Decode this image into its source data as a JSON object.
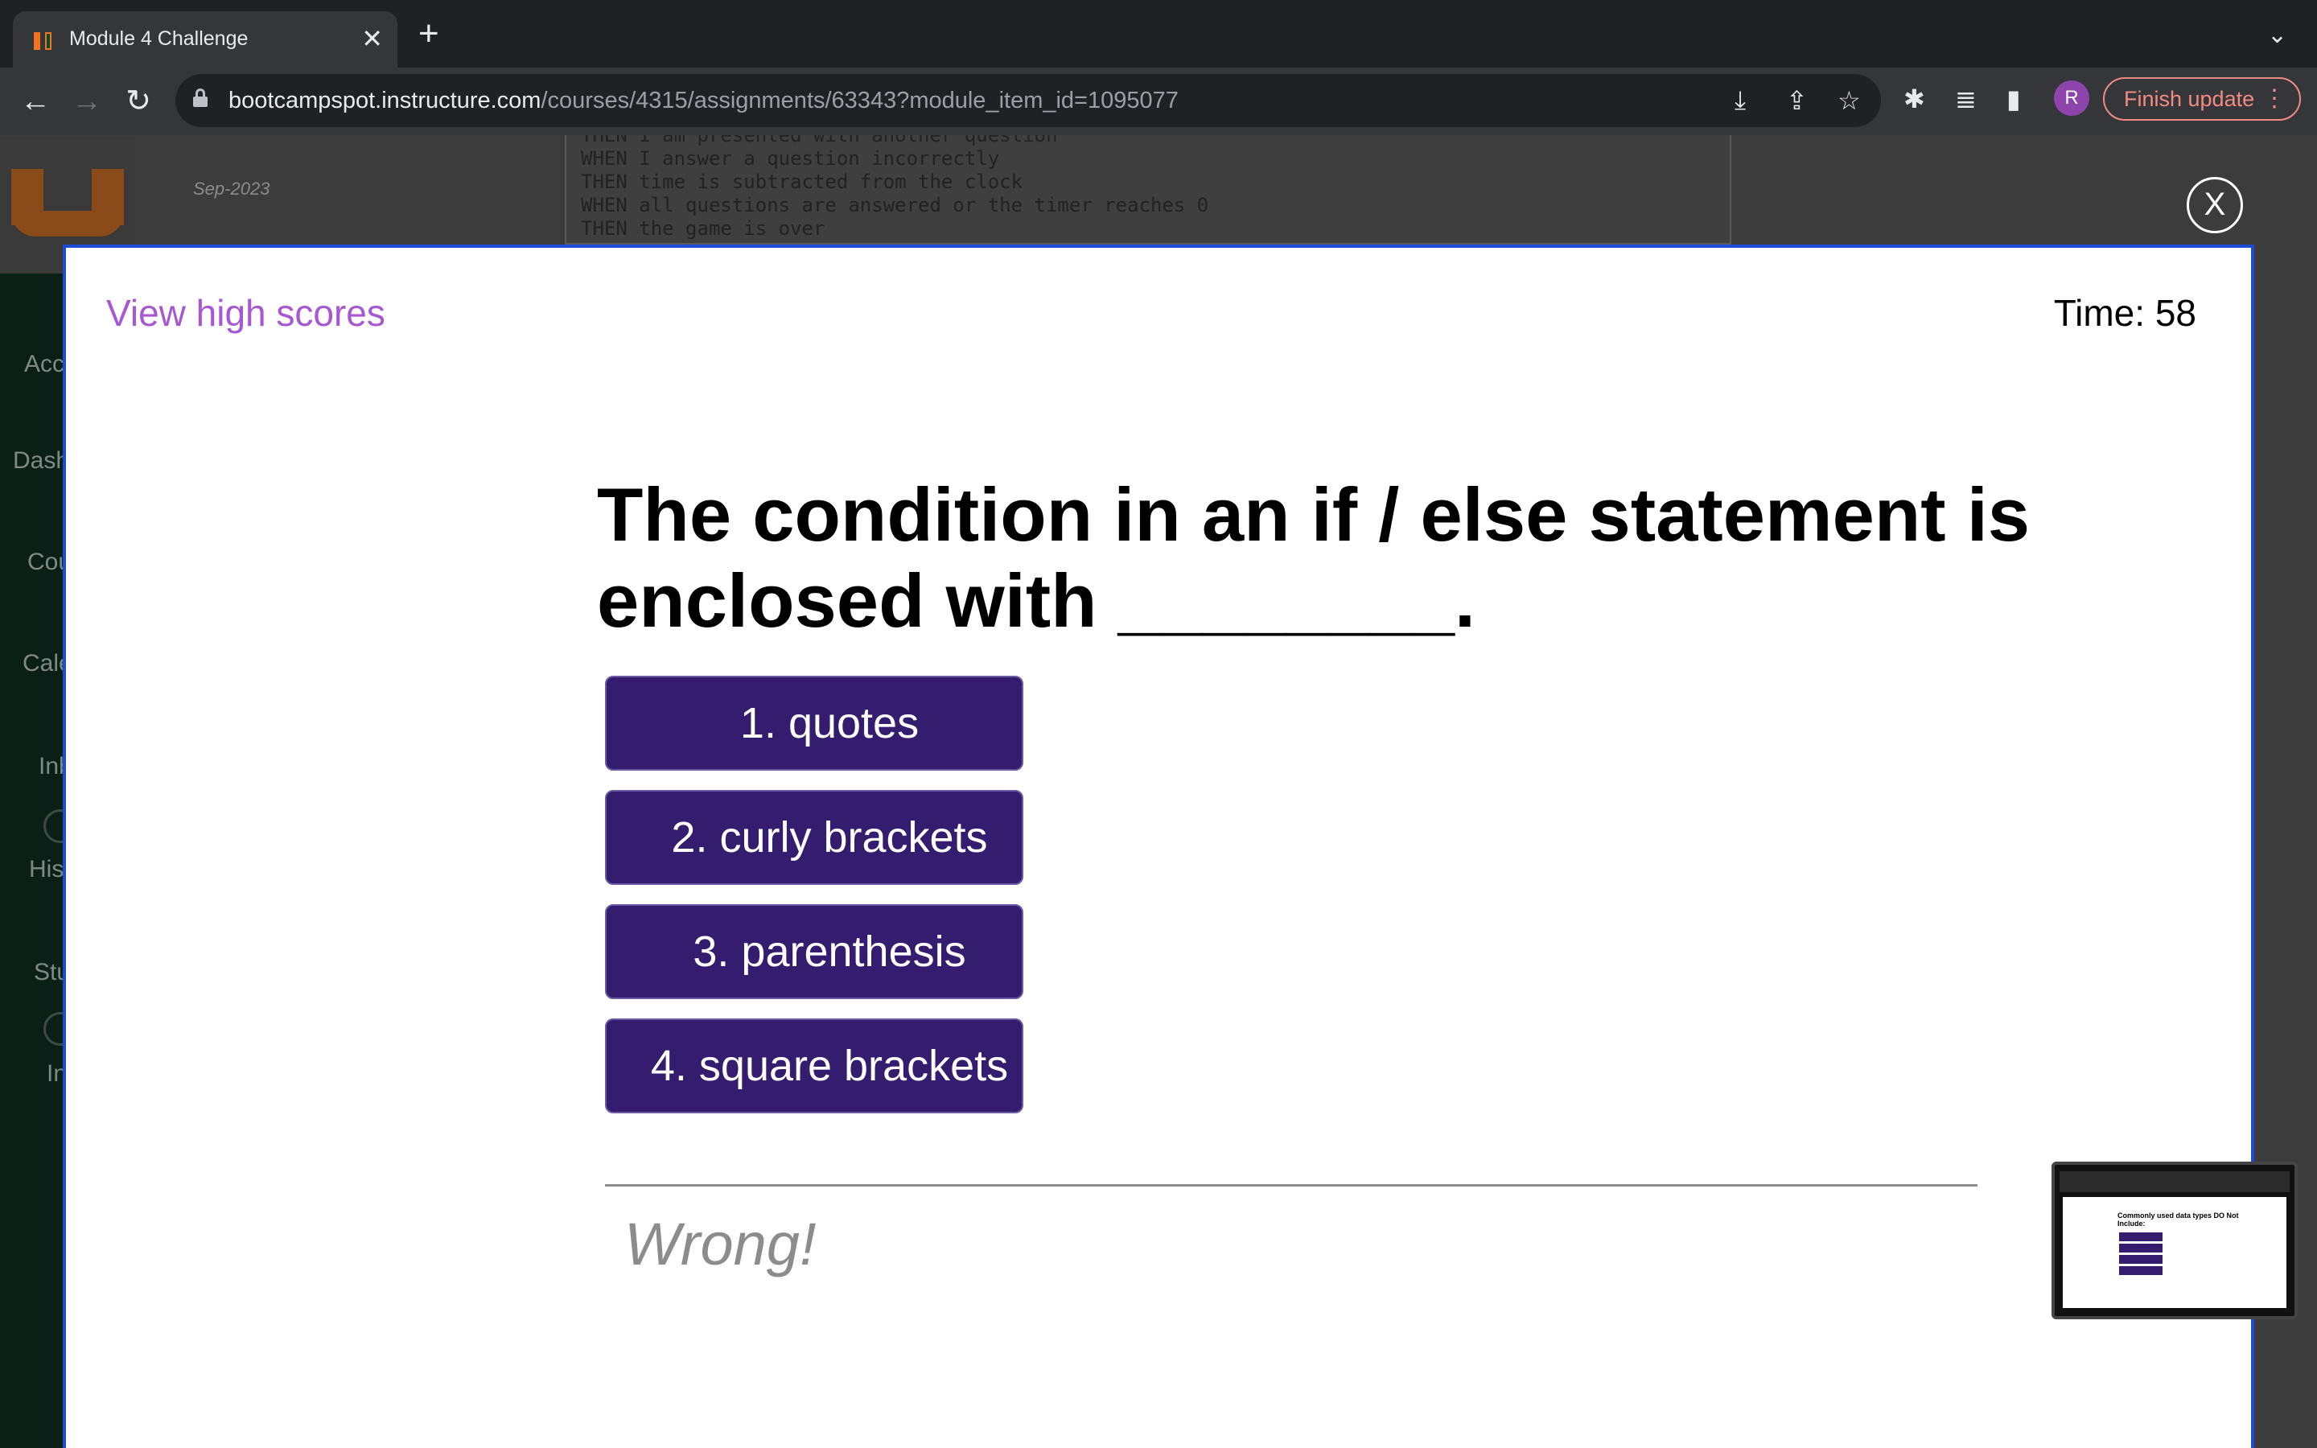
{
  "browser": {
    "tab_title": "Module 4 Challenge",
    "tab_close": "✕",
    "new_tab": "+",
    "url_domain": "bootcampspot.instructure.com",
    "url_path": "/courses/4315/assignments/63343?module_item_id=1095077",
    "profile_initial": "R",
    "finish_update_label": "Finish update"
  },
  "background_page": {
    "date": "Sep-2023",
    "nav_labels": [
      "Acc",
      "Dash",
      "Cou",
      "Cale",
      "Inb",
      "His",
      "Stu",
      "In"
    ],
    "code_lines": [
      "THEN I am presented with another question",
      "WHEN I answer a question incorrectly",
      "THEN time is subtracted from the clock",
      "WHEN all questions are answered or the timer reaches 0",
      "THEN the game is over"
    ],
    "close_label": "X"
  },
  "quiz": {
    "view_high_scores": "View high scores",
    "timer": "Time: 58",
    "question": "The condition in an if / else statement is enclosed with ________.",
    "answers": [
      "1. quotes",
      "2. curly brackets",
      "3. parenthesis",
      "4. square brackets"
    ],
    "feedback": "Wrong!"
  },
  "pip_preview": {
    "question": "Commonly used data types DO Not Include:"
  },
  "colors": {
    "accent_purple": "#a857d2",
    "answer_button": "#341c6e",
    "modal_border": "#1c4bd6",
    "finish_update": "#f28b82"
  }
}
